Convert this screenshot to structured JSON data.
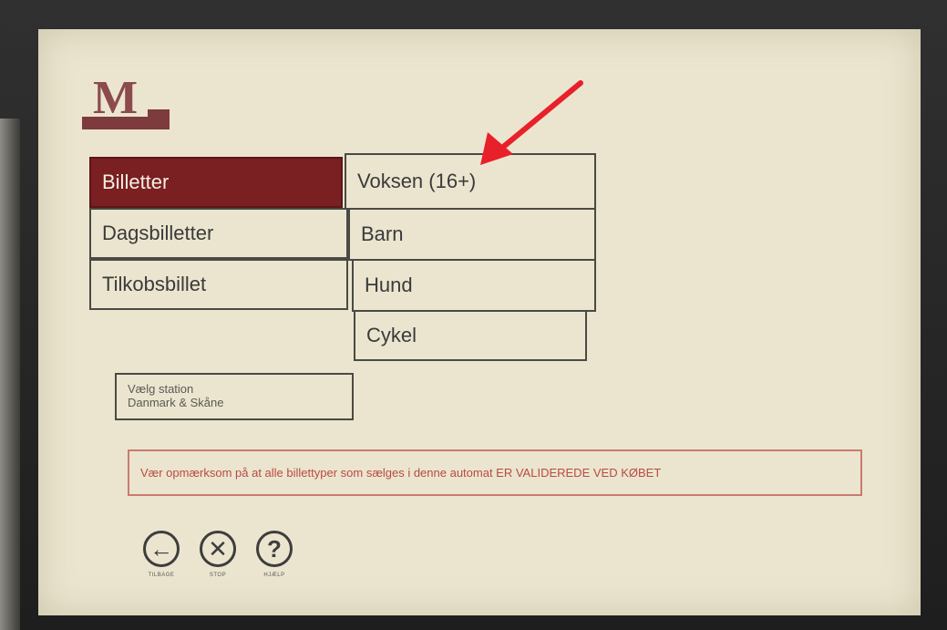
{
  "menu": {
    "left": [
      {
        "label": "Billetter",
        "selected": true
      },
      {
        "label": "Dagsbilletter",
        "selected": false
      },
      {
        "label": "Tilkobsbillet",
        "selected": false
      }
    ],
    "right": [
      {
        "label": "Voksen (16+)"
      },
      {
        "label": "Barn"
      },
      {
        "label": "Hund"
      },
      {
        "label": "Cykel"
      }
    ]
  },
  "station": {
    "line1": "Vælg station",
    "line2": "Danmark & Skåne"
  },
  "notice": "Vær opmærksom på at alle billettyper som sælges i denne automat ER VALIDEREDE VED KØBET",
  "controls": [
    {
      "icon": "left-arrow-icon",
      "label": "TILBAGE"
    },
    {
      "icon": "close-icon",
      "label": "STOP"
    },
    {
      "icon": "help-icon",
      "label": "HJÆLP"
    }
  ],
  "colors": {
    "selected": "#7a1f22",
    "notice": "#b94a44",
    "arrow": "#e8202a"
  }
}
